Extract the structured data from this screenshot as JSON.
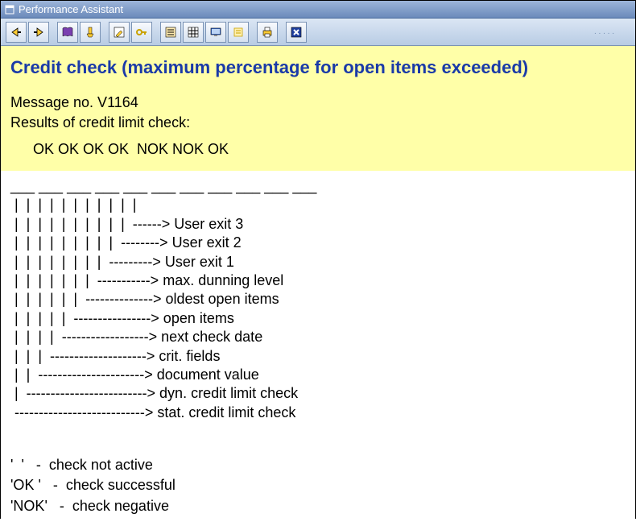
{
  "window": {
    "title": "Performance Assistant"
  },
  "toolbar_icons": [
    "back-icon",
    "forward-icon",
    "book-icon",
    "tech-info-icon",
    "edit-icon",
    "key-icon",
    "list-icon",
    "grid-icon",
    "display-icon",
    "notes-icon",
    "print-icon",
    "close-icon"
  ],
  "heading": "Credit check (maximum percentage for open items exceeded)",
  "message_no": "Message no. V1164",
  "intro": "Results of credit limit check:",
  "result_line": "OK OK OK OK  NOK NOK OK",
  "diagram_lines": [
    "___ ___ ___ ___ ___ ___ ___ ___ ___ ___ ___",
    " |  |  |  |  |  |  |  |  |  |  |",
    " |  |  |  |  |  |  |  |  |  |  ------> User exit 3",
    " |  |  |  |  |  |  |  |  |  --------> User exit 2",
    " |  |  |  |  |  |  |  |  ---------> User exit 1",
    " |  |  |  |  |  |  |  -----------> max. dunning level",
    " |  |  |  |  |  |  --------------> oldest open items",
    " |  |  |  |  |  ----------------> open items",
    " |  |  |  |  ------------------> next check date",
    " |  |  |  --------------------> crit. fields",
    " |  |  ----------------------> document value",
    " |  -------------------------> dyn. credit limit check",
    " ---------------------------> stat. credit limit check"
  ],
  "legend_lines": [
    "'  '   -  check not active",
    "'OK '   -  check successful",
    "'NOK'   -  check negative"
  ]
}
